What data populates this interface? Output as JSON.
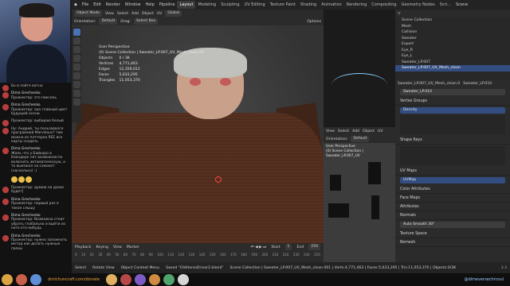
{
  "stream": {
    "chat": [
      {
        "name": "",
        "text": "Бо в пойте ватно"
      },
      {
        "name": "Dima Grechenko",
        "text": "Прожектор: это пиксель"
      },
      {
        "name": "Dima Grechenko",
        "text": "Прожектор: ааа главный цвет будущей осени"
      },
      {
        "name": "",
        "text": "Прожектор: выбираю белый"
      },
      {
        "name": "",
        "text": "Ну: Андрей, ты пользовался программой Marvelous? там можно из паттерна REE все карты создать"
      },
      {
        "name": "Dima Grechenko",
        "text": "Жаль что у Байкаро в блендере нет возможности включить автоматическую, а то выезжал на самокат (насколько) :)"
      },
      {
        "name": "",
        "text": "Прожектор: думаю на уроке будет]"
      },
      {
        "name": "Dima Grechenko",
        "text": "Прожектор: первый раз я такое слышу"
      },
      {
        "name": "Dima Grechenko",
        "text": "Прожектор: Возможно стоит убрать глобально и выйти из него кто-нибудь"
      },
      {
        "name": "Dima Grechenko",
        "text": "Прожектор: нужно запомнить метод как делать нужные папки"
      }
    ],
    "bottom_url": "dnrichuncraft.com/donate",
    "telegram": "@dimeversechrcoul"
  },
  "topbar": {
    "menus": [
      "File",
      "Edit",
      "Render",
      "Window",
      "Help",
      "Pipeline"
    ],
    "workspaces": [
      "Layout",
      "Modeling",
      "Sculpting",
      "UV Editing",
      "Texture Paint",
      "Shading",
      "Animation",
      "Rendering",
      "Compositing",
      "Geometry Nodes",
      "Scri..."
    ],
    "active_workspace": "Layout",
    "scene_label": "Scene"
  },
  "viewport": {
    "mode_label": "Object Mode",
    "menus": [
      "View",
      "Select",
      "Add",
      "Object",
      "UV"
    ],
    "orientation_label": "Orientation:",
    "orientation_value": "Default",
    "drag_label": "Drag:",
    "drag_value": "Select Box",
    "global_label": "Global",
    "options_label": "Options",
    "title": "User Perspective",
    "collection_path": "(0) Scene Collection | Sweater_LP.007_UV_Mesh_clean.00",
    "stats": [
      {
        "label": "Objects",
        "value": "0 / 3K"
      },
      {
        "label": "Vertices",
        "value": "4,771,463"
      },
      {
        "label": "Edges",
        "value": "12,359,012"
      },
      {
        "label": "Faces",
        "value": "5,633,295"
      },
      {
        "label": "Triangles",
        "value": "11,053,370"
      }
    ]
  },
  "timeline": {
    "items": [
      "Playback",
      "Keying",
      "View",
      "Marker"
    ],
    "start_label": "Start",
    "start_value": "1",
    "end_label": "End",
    "end_value": "250",
    "ticks": [
      "0",
      "10",
      "20",
      "30",
      "40",
      "50",
      "60",
      "70",
      "80",
      "90",
      "100",
      "110",
      "120",
      "130",
      "140",
      "150",
      "160",
      "170",
      "180",
      "190",
      "200",
      "210",
      "220",
      "230",
      "240",
      "250"
    ]
  },
  "secondary_viewport": {
    "menus": [
      "View",
      "Select",
      "Add",
      "Object",
      "UV"
    ],
    "orientation_value": "Default",
    "title": "User Perspective",
    "collection_path": "(0) Scene Collection | Sweater_LP.007_UV"
  },
  "outliner": {
    "items": [
      "Scene Collection",
      "Mesh",
      "Collision",
      "Sweater",
      "Export",
      "Eye_R",
      "Eye_L",
      "Sweater_LP.007",
      "Sweater_LP.007_UV_Mesh_clean"
    ],
    "selected_index": 8
  },
  "properties": {
    "object_name": "Sweater_LP.007_UV_Mesh_clean.0",
    "data_name": "Sweater_LP.010",
    "mesh_name": "Sweater_LP.010",
    "vertex_groups_title": "Vertex Groups",
    "vertex_group_item": "Density",
    "shape_keys_title": "Shape Keys",
    "uv_maps_title": "UV Maps",
    "uv_map_item": "UVMap",
    "sections": [
      "Color Attributes",
      "Face Maps",
      "Attributes",
      "Normals"
    ],
    "auto_smooth_label": "Auto Smooth",
    "auto_smooth_value": "30°",
    "extra_sections": [
      "Texture Space",
      "Remesh"
    ]
  },
  "statusbar": {
    "items": [
      "Select",
      "Rotate View",
      "Object Context Menu"
    ],
    "saved_message": "Saved \"OldHorseDriver2.blend\"",
    "info": "Scene Collection | Sweater_LP.007_UV_Mesh_clean.001 | Verts:4,771,463 | Faces:5,633,295 | Tris:11,053,370 | Objects:0/3K",
    "version": "3.3"
  }
}
